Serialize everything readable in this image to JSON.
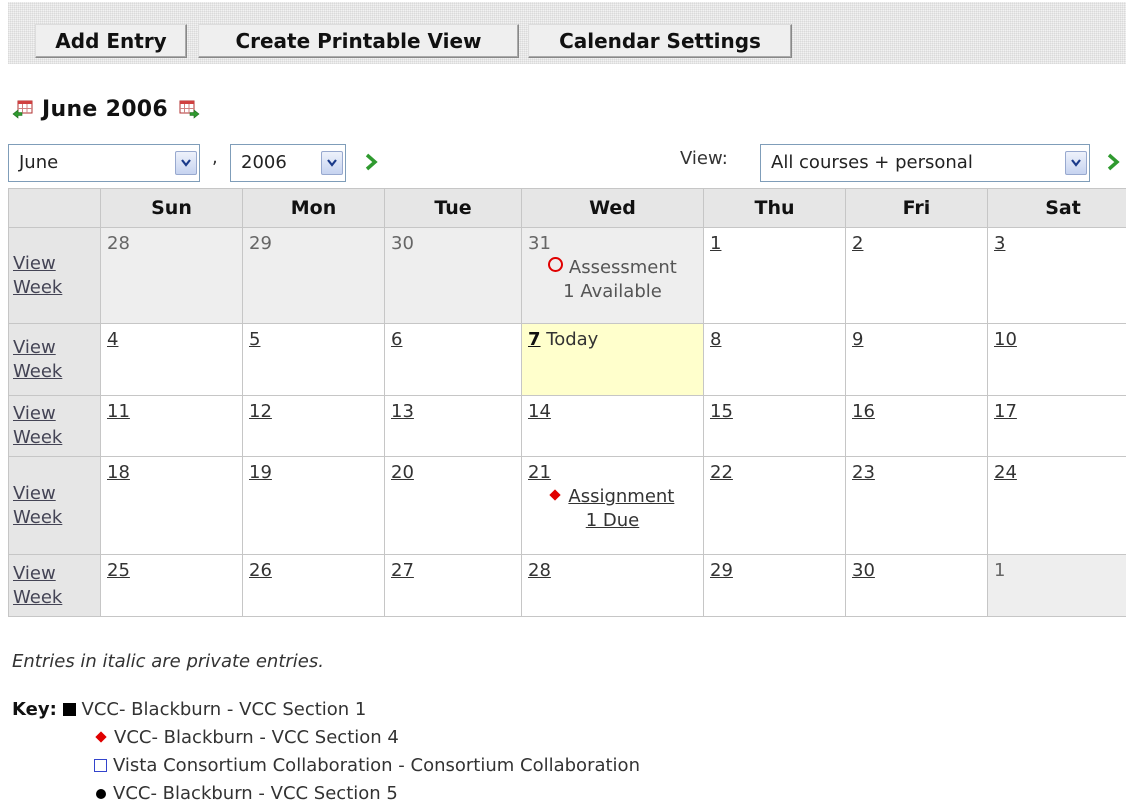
{
  "toolbar": {
    "add_entry": "Add Entry",
    "printable_view": "Create Printable View",
    "calendar_settings": "Calendar Settings"
  },
  "header": {
    "title": "June 2006"
  },
  "controls": {
    "month": "June",
    "comma": ",",
    "year": "2006",
    "view_label": "View:",
    "view_value": "All courses + personal"
  },
  "table": {
    "days": [
      "Sun",
      "Mon",
      "Tue",
      "Wed",
      "Thu",
      "Fri",
      "Sat"
    ],
    "view_week": [
      "View",
      "Week"
    ],
    "weeks": [
      [
        "28",
        "29",
        "30",
        "31",
        "1",
        "2",
        "3"
      ],
      [
        "4",
        "5",
        "6",
        "7",
        "8",
        "9",
        "10"
      ],
      [
        "11",
        "12",
        "13",
        "14",
        "15",
        "16",
        "17"
      ],
      [
        "18",
        "19",
        "20",
        "21",
        "22",
        "23",
        "24"
      ],
      [
        "25",
        "26",
        "27",
        "28",
        "29",
        "30",
        "1"
      ]
    ]
  },
  "events": {
    "assessment": [
      "Assessment",
      "1 Available"
    ],
    "today_label": "Today",
    "assignment": [
      "Assignment",
      "1 Due"
    ]
  },
  "note": "Entries in italic are private entries.",
  "key": {
    "label": "Key:",
    "entries": [
      "VCC- Blackburn - VCC Section 1",
      "VCC- Blackburn - VCC Section 4",
      "Vista Consortium Collaboration - Consortium Collaboration",
      "VCC- Blackburn - VCC Section 5"
    ]
  },
  "colors": {
    "today_bg": "#ffffcc",
    "event_red": "#e00000",
    "header_bg": "#e6e6e6"
  }
}
